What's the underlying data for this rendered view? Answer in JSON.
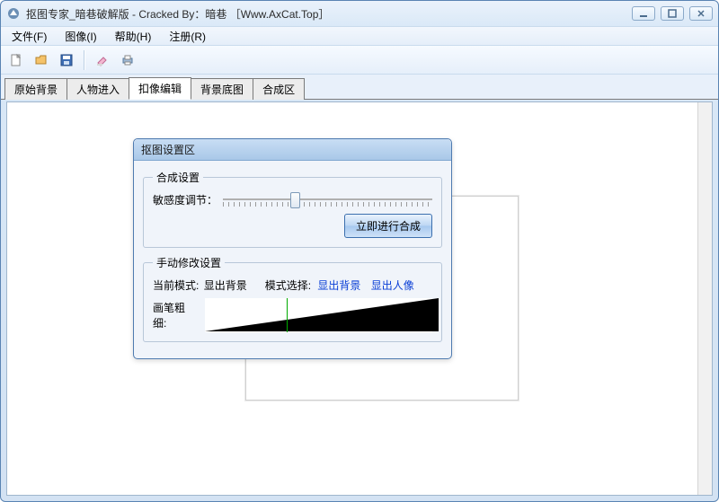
{
  "window": {
    "title": "抠图专家_暗巷破解版 - Cracked By：暗巷 ［Www.AxCat.Top］"
  },
  "menu": {
    "file": "文件(F)",
    "image": "图像(I)",
    "help": "帮助(H)",
    "register": "注册(R)"
  },
  "tabs": {
    "items": [
      {
        "label": "原始背景"
      },
      {
        "label": "人物进入"
      },
      {
        "label": "扣像编辑"
      },
      {
        "label": "背景底图"
      },
      {
        "label": "合成区"
      }
    ],
    "active_index": 2
  },
  "dialog": {
    "title": "抠图设置区",
    "compose": {
      "legend": "合成设置",
      "slider_label": "敏感度调节：",
      "button": "立即进行合成"
    },
    "manual": {
      "legend": "手动修改设置",
      "mode_label": "当前模式:",
      "mode_value": "显出背景",
      "select_label": "模式选择:",
      "option_bg": "显出背景",
      "option_person": "显出人像",
      "brush_label": "画笔粗细:"
    }
  },
  "icons": {
    "new": "new-file-icon",
    "open": "open-folder-icon",
    "save": "save-icon",
    "eraser": "eraser-icon",
    "print": "print-icon"
  }
}
